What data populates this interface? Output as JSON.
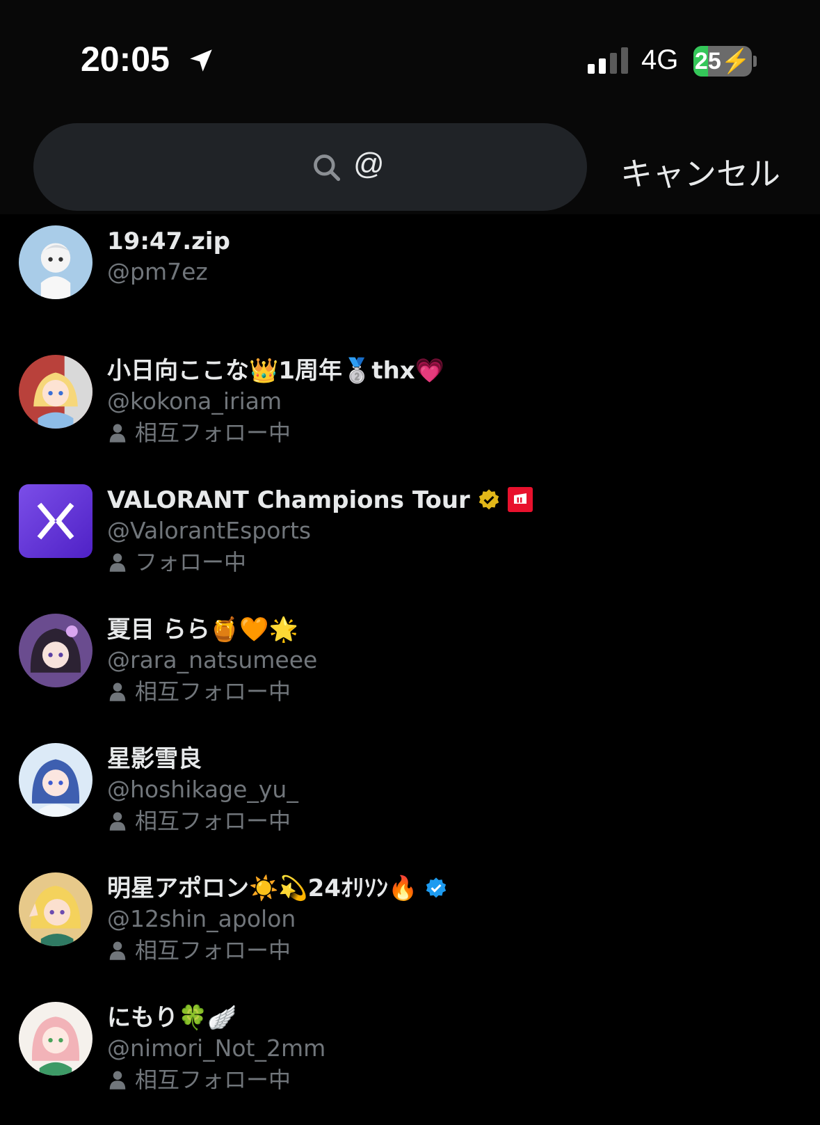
{
  "status_bar": {
    "time": "20:05",
    "network": "4G",
    "battery_level": "25",
    "battery_fraction": 0.25,
    "location_icon": "location-arrow-icon",
    "signal_icon": "cellular-signal-icon"
  },
  "search": {
    "value": "@",
    "cancel_label": "キャンセル"
  },
  "results": [
    {
      "name": "19:47.zip",
      "handle": "@pm7ez",
      "follow_status": ""
    },
    {
      "name": "小日向ここな👑1周年🥈thx💗",
      "handle": "@kokona_iriam",
      "follow_status": "相互フォロー中"
    },
    {
      "name": "VALORANT Champions Tour",
      "handle": "@ValorantEsports",
      "follow_status": "フォロー中",
      "badges": [
        "gold-verified-icon",
        "riot-affiliate-icon"
      ]
    },
    {
      "name": "夏目 らら🍯🧡🌟",
      "handle": "@rara_natsumeee",
      "follow_status": "相互フォロー中"
    },
    {
      "name": "星影雪良",
      "handle": "@hoshikage_yu_",
      "follow_status": "相互フォロー中"
    },
    {
      "name": "明星アポロン☀️💫24ｵﾘｿﾝ🔥",
      "handle": "@12shin_apolon",
      "follow_status": "相互フォロー中",
      "badges": [
        "blue-verified-icon"
      ]
    },
    {
      "name": "にもり🍀🪽",
      "handle": "@nimori_Not_2mm",
      "follow_status": "相互フォロー中"
    }
  ],
  "colors": {
    "background": "#000000",
    "search_box": "#202327",
    "text_primary": "#e7e9ea",
    "text_secondary": "#71767b",
    "battery_green": "#34c759",
    "verified_blue": "#1d9bf0",
    "verified_gold": "#e2b719"
  }
}
